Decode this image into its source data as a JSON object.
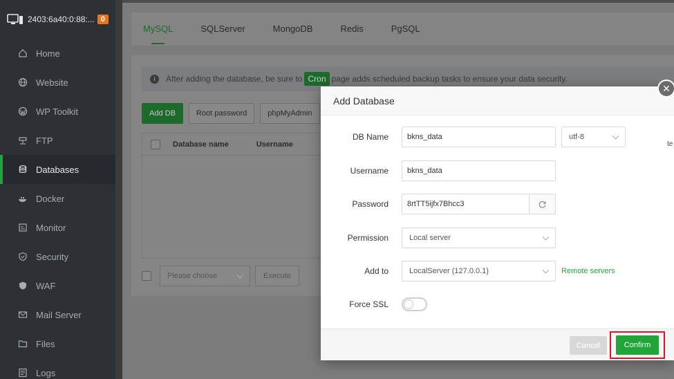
{
  "sidebar": {
    "server_name": "2403:6a40:0:88:...",
    "alert_count": "0",
    "items": [
      {
        "label": "Home",
        "icon": "home-icon"
      },
      {
        "label": "Website",
        "icon": "globe-icon"
      },
      {
        "label": "WP Toolkit",
        "icon": "wordpress-icon"
      },
      {
        "label": "FTP",
        "icon": "ftp-icon"
      },
      {
        "label": "Databases",
        "icon": "database-icon"
      },
      {
        "label": "Docker",
        "icon": "docker-icon"
      },
      {
        "label": "Monitor",
        "icon": "monitor-icon"
      },
      {
        "label": "Security",
        "icon": "shield-icon"
      },
      {
        "label": "WAF",
        "icon": "waf-shield-icon"
      },
      {
        "label": "Mail Server",
        "icon": "mail-icon"
      },
      {
        "label": "Files",
        "icon": "folder-icon"
      },
      {
        "label": "Logs",
        "icon": "logs-icon"
      }
    ],
    "active_item": "Databases"
  },
  "tabs": [
    "MySQL",
    "SQLServer",
    "MongoDB",
    "Redis",
    "PgSQL"
  ],
  "active_tab": "MySQL",
  "alert": {
    "text_before": "After adding the database, be sure to",
    "cron": "Cron",
    "text_after": "page adds scheduled backup tasks to ensure your data security."
  },
  "toolbar": {
    "add_db": "Add DB",
    "root_password": "Root password",
    "phpmyadmin": "phpMyAdmin"
  },
  "table": {
    "columns": [
      "Database name",
      "Username"
    ]
  },
  "bulk": {
    "placeholder": "Please choose",
    "execute": "Execute"
  },
  "modal": {
    "title": "Add Database",
    "db_name_label": "DB Name",
    "db_name_value": "bkns_data",
    "charset_value": "utf-8",
    "username_label": "Username",
    "username_value": "bkns_data",
    "password_label": "Password",
    "password_value": "8rtTT5ijfx7Bhcc3",
    "permission_label": "Permission",
    "permission_value": "Local server",
    "add_to_label": "Add to",
    "add_to_value": "LocalServer (127.0.0.1)",
    "remote_servers": "Remote servers",
    "force_ssl_label": "Force SSL",
    "force_ssl_on": false,
    "cancel": "Cancel",
    "confirm": "Confirm"
  },
  "colors": {
    "accent": "#20a53a",
    "highlight_border": "#e0142b",
    "sidebar_bg": "#2d3136"
  }
}
